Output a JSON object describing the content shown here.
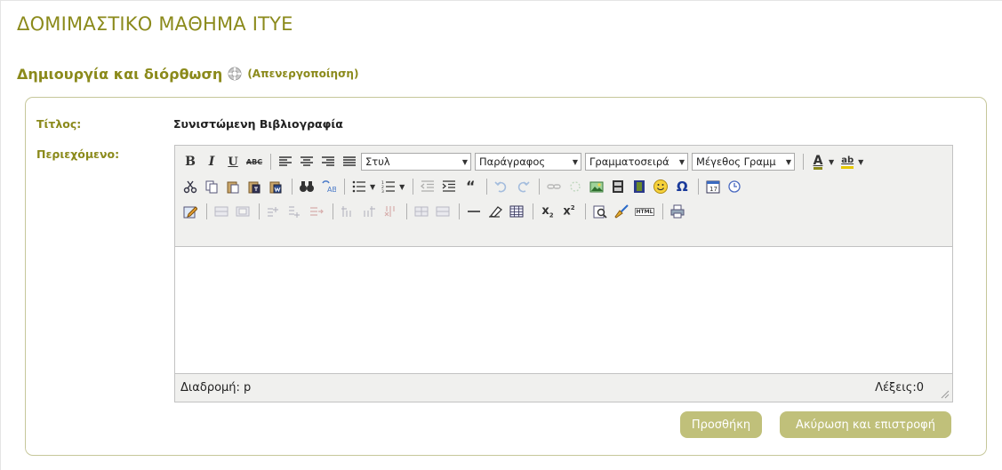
{
  "page": {
    "course_title": "ΔΟΜΙΜΑΣΤΙΚΟ ΜΑΘΗΜΑ ΙΤΥΕ",
    "section_title": "Δημιουργία και διόρθωση",
    "deactivate_link": "(Απενεργοποίηση)",
    "accent_color": "#8b8a1b",
    "button_color": "#c0c07a"
  },
  "form": {
    "title_label": "Τίτλος:",
    "title_value": "Συνιστώμενη Βιβλιογραφία",
    "content_label": "Περιεχόμενο:"
  },
  "editor": {
    "style_select": "Στυλ",
    "format_select": "Παράγραφος",
    "font_select": "Γραμματοσειρά",
    "size_select": "Μέγεθος Γραμμ",
    "path_label": "Διαδρομή: p",
    "word_count": "Λέξεις:0",
    "text_icons": {
      "bold": "B",
      "italic": "I",
      "underline": "U",
      "strikethrough": "ABC",
      "font_color": "A",
      "highlight": "ab",
      "html_source": "HTML"
    }
  },
  "buttons": {
    "add": "Προσθήκη",
    "cancel_back": "Ακύρωση και επιστροφή"
  }
}
